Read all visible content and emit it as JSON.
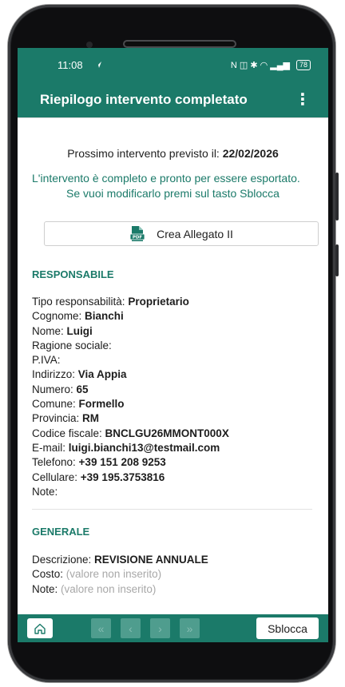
{
  "status_bar": {
    "time": "11:08",
    "icons": "N ◫ ✱ ◠ ▂▄▆",
    "battery": "78"
  },
  "app_bar": {
    "title": "Riepilogo intervento completato",
    "menu": "⋮"
  },
  "next_intervention": {
    "label": "Prossimo intervento previsto il: ",
    "date": "22/02/2026"
  },
  "messages": {
    "complete": "L'intervento è completo e pronto per essere esportato.",
    "unlock_hint": "Se vuoi modificarlo premi sul tasto Sblocca"
  },
  "pdf_button": {
    "label": "Crea Allegato II",
    "icon_text": "PDF"
  },
  "responsabile": {
    "title": "RESPONSABILE",
    "fields": [
      {
        "label": "Tipo responsabilità: ",
        "value": "Proprietario"
      },
      {
        "label": "Cognome: ",
        "value": "Bianchi"
      },
      {
        "label": "Nome: ",
        "value": "Luigi"
      },
      {
        "label": "Ragione sociale: ",
        "value": ""
      },
      {
        "label": "P.IVA: ",
        "value": ""
      },
      {
        "label": "Indirizzo: ",
        "value": "Via Appia"
      },
      {
        "label": "Numero: ",
        "value": "65"
      },
      {
        "label": "Comune: ",
        "value": "Formello"
      },
      {
        "label": "Provincia: ",
        "value": "RM"
      },
      {
        "label": "Codice fiscale: ",
        "value": "BNCLGU26MMONT000X"
      },
      {
        "label": "E-mail: ",
        "value": "luigi.bianchi13@testmail.com"
      },
      {
        "label": "Telefono: ",
        "value": "+39 151 208 9253"
      },
      {
        "label": "Cellulare: ",
        "value": "+39 195.3753816"
      },
      {
        "label": "Note: ",
        "value": ""
      }
    ]
  },
  "generale": {
    "title": "GENERALE",
    "descrizione_label": "Descrizione: ",
    "descrizione_value": "REVISIONE ANNUALE",
    "costo_label": "Costo: ",
    "costo_value": "(valore non inserito)",
    "note_label": "Note: ",
    "note_value": "(valore non inserito)"
  },
  "bottom_bar": {
    "first": "«",
    "prev": "‹",
    "next": "›",
    "last": "»",
    "unlock_label": "Sblocca"
  },
  "colors": {
    "primary": "#1b7a69",
    "disabled_nav": "#4f9d8e"
  }
}
